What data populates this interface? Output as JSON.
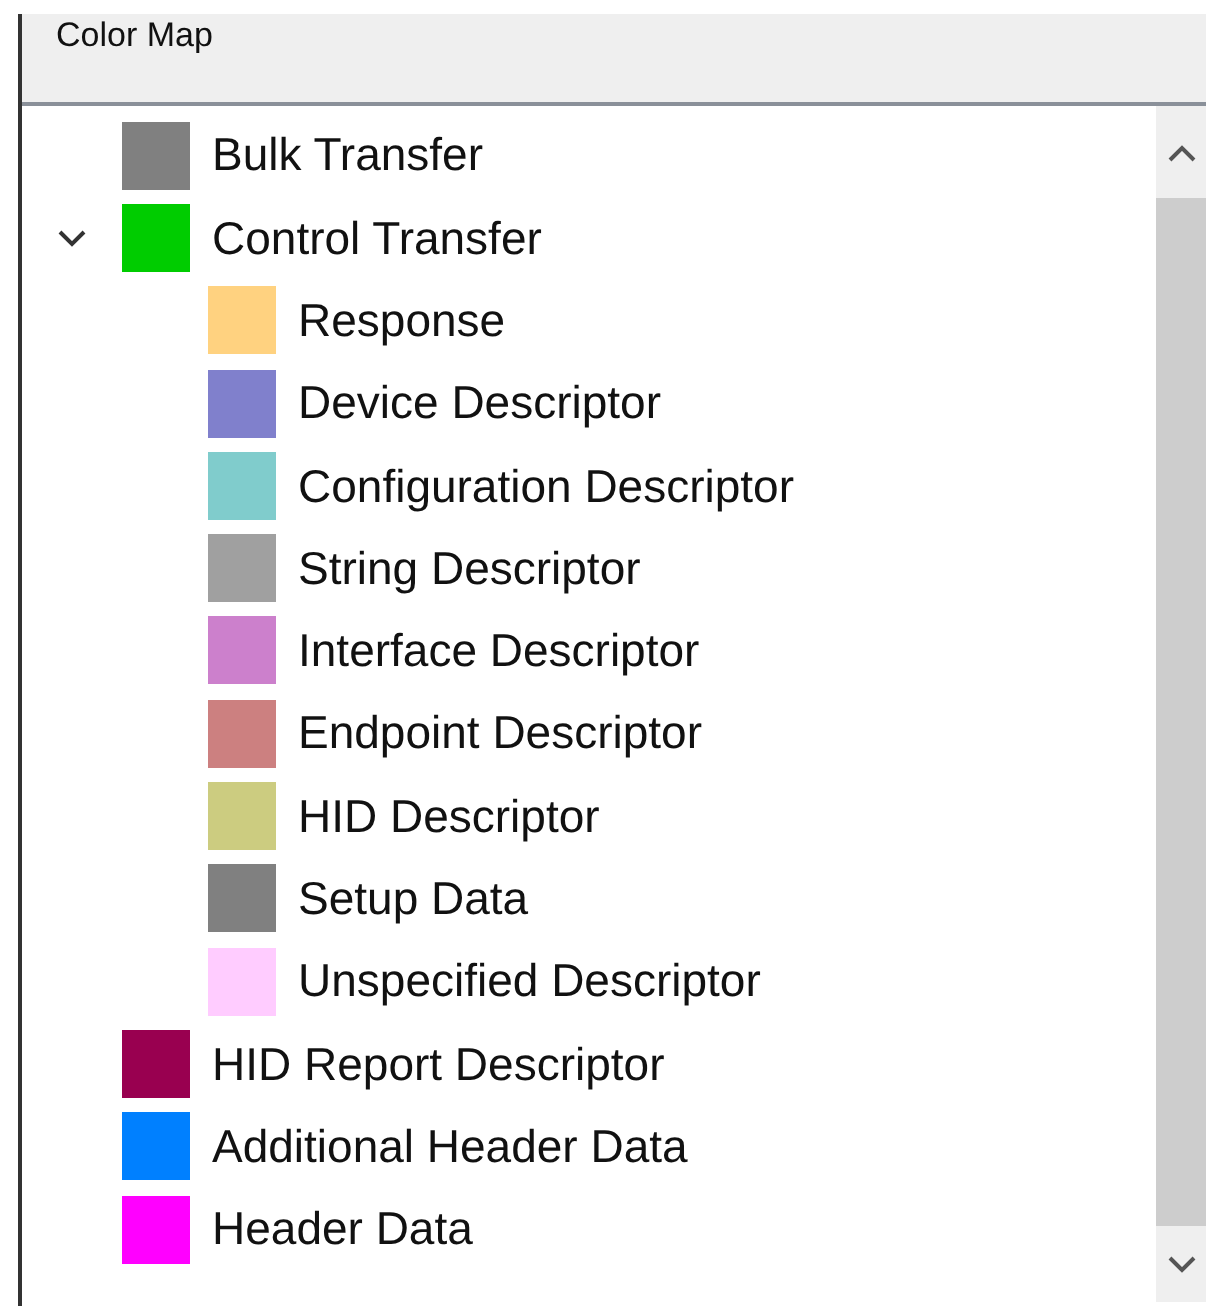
{
  "panel": {
    "title": "Color Map"
  },
  "tree": [
    {
      "label": "Bulk Transfer",
      "color": "#808080"
    },
    {
      "label": "Control Transfer",
      "color": "#00cc00",
      "expanded": true,
      "children": [
        {
          "label": "Response",
          "color": "#ffd280"
        },
        {
          "label": "Device Descriptor",
          "color": "#8080cc"
        },
        {
          "label": "Configuration Descriptor",
          "color": "#80cccc"
        },
        {
          "label": "String Descriptor",
          "color": "#a0a0a0"
        },
        {
          "label": "Interface Descriptor",
          "color": "#cc80cc"
        },
        {
          "label": "Endpoint Descriptor",
          "color": "#cc8080"
        },
        {
          "label": "HID Descriptor",
          "color": "#cccc80"
        },
        {
          "label": "Setup Data",
          "color": "#808080"
        },
        {
          "label": "Unspecified Descriptor",
          "color": "#ffccff"
        }
      ]
    },
    {
      "label": "HID Report Descriptor",
      "color": "#990050"
    },
    {
      "label": "Additional Header Data",
      "color": "#0080ff"
    },
    {
      "label": "Header Data",
      "color": "#ff00ff"
    }
  ]
}
